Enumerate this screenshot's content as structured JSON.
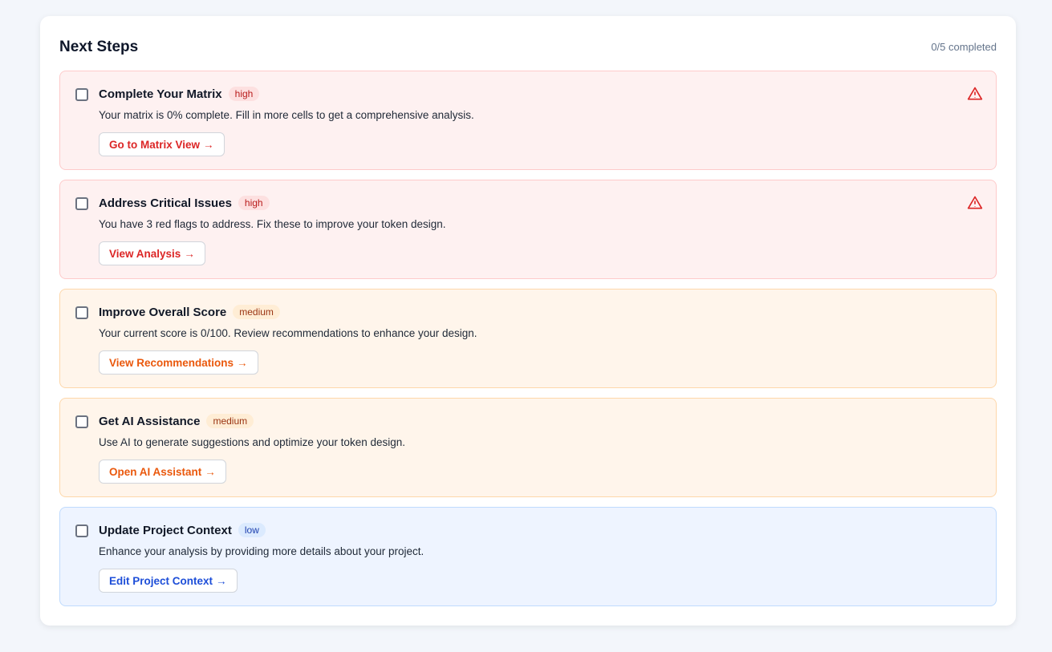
{
  "header": {
    "title": "Next Steps",
    "progress": "0/5 completed"
  },
  "items": [
    {
      "title": "Complete Your Matrix",
      "priority": "high",
      "description": "Your matrix is 0% complete. Fill in more cells to get a comprehensive analysis.",
      "action": "Go to Matrix View",
      "arrow": "→",
      "warning": true,
      "checked": false
    },
    {
      "title": "Address Critical Issues",
      "priority": "high",
      "description": "You have 3 red flags to address. Fix these to improve your token design.",
      "action": "View Analysis",
      "arrow": "→",
      "warning": true,
      "checked": false
    },
    {
      "title": "Improve Overall Score",
      "priority": "medium",
      "description": "Your current score is 0/100. Review recommendations to enhance your design.",
      "action": "View Recommendations",
      "arrow": "→",
      "warning": false,
      "checked": false
    },
    {
      "title": "Get AI Assistance",
      "priority": "medium",
      "description": "Use AI to generate suggestions and optimize your token design.",
      "action": "Open AI Assistant",
      "arrow": "→",
      "warning": false,
      "checked": false
    },
    {
      "title": "Update Project Context",
      "priority": "low",
      "description": "Enhance your analysis by providing more details about your project.",
      "action": "Edit Project Context",
      "arrow": "→",
      "warning": false,
      "checked": false
    }
  ]
}
